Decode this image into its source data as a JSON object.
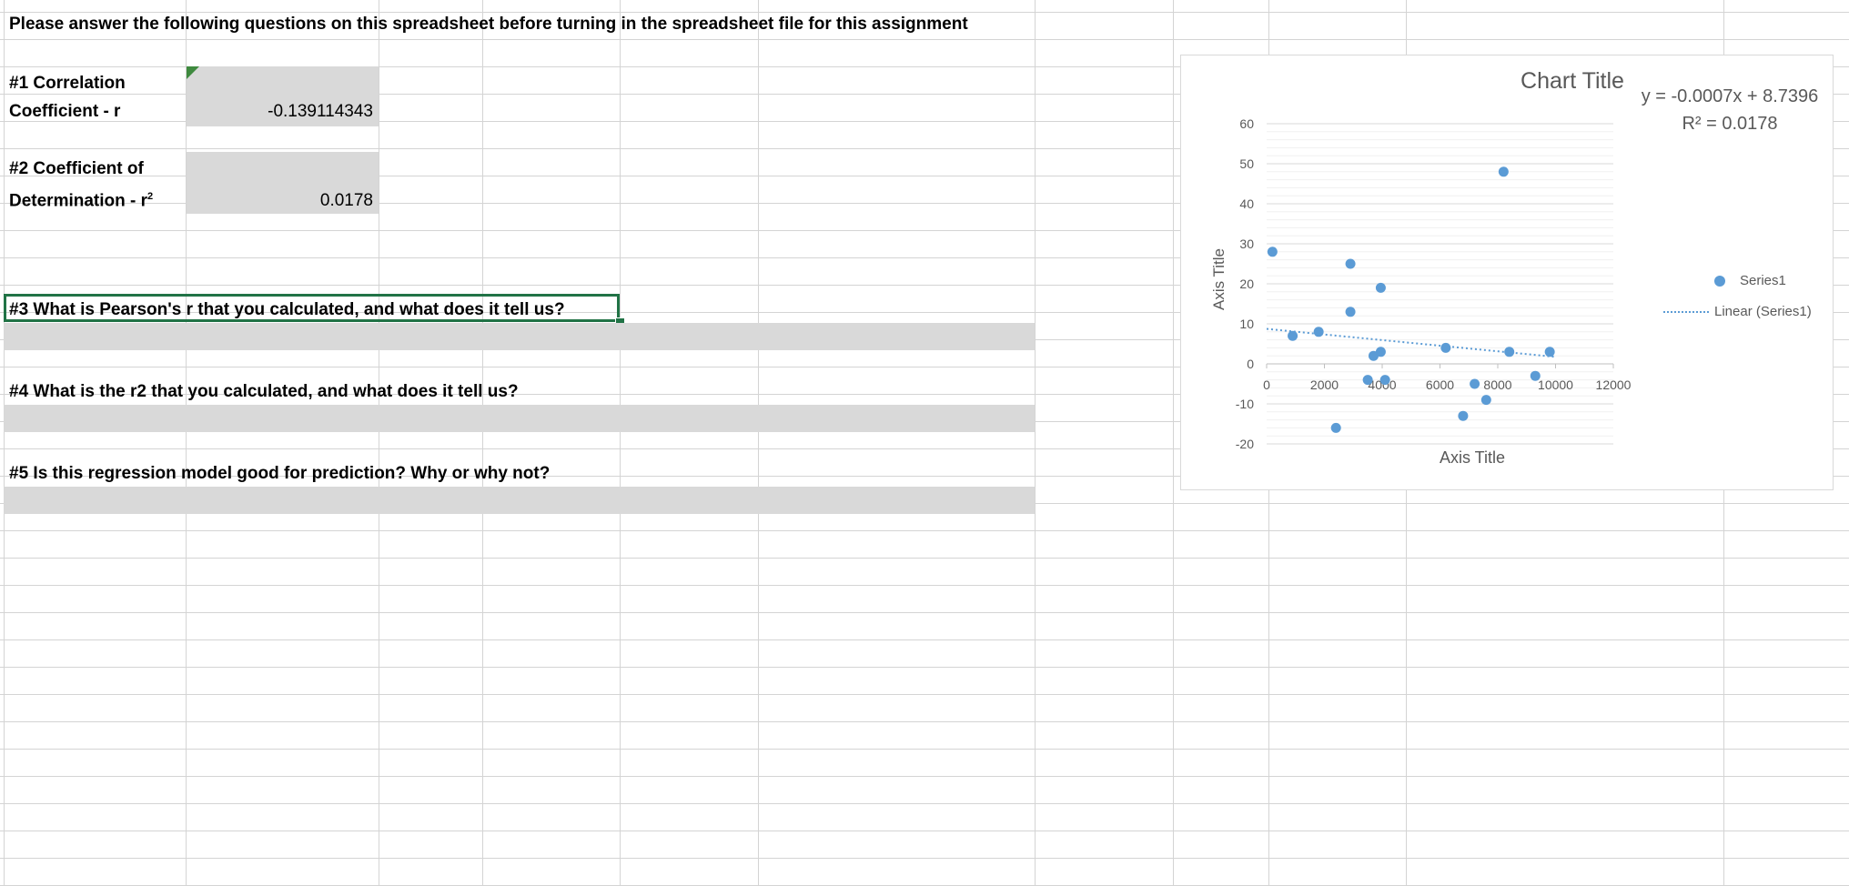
{
  "sheet": {
    "instruction": "Please answer the following questions on this spreadsheet before turning in the spreadsheet file for this assignment",
    "q1": {
      "line1": "#1 Correlation",
      "line2": "Coefficient - r",
      "value": "-0.139114343"
    },
    "q2": {
      "line1": "#2 Coefficient of",
      "line2": "Determination - r",
      "sup": "2",
      "value": "0.0178"
    },
    "q3": "#3  What is Pearson's r that you calculated, and what does it tell us?",
    "q4": "#4 What is the r2 that you calculated, and what does it tell us?",
    "q5": "#5 Is this regression model good for prediction? Why or why not?"
  },
  "colors": {
    "grid": "#d4d4d4",
    "answer_shade": "#d9d9d9",
    "selection": "#217346",
    "marker": "#5b9bd5",
    "chart_text": "#595959"
  },
  "chart_data": {
    "type": "scatter",
    "title": "Chart Title",
    "xlabel": "Axis Title",
    "ylabel": "Axis Title",
    "xlim": [
      0,
      12000
    ],
    "ylim": [
      -20,
      60
    ],
    "x_ticks": [
      "0",
      "2000",
      "4000",
      "6000",
      "8000",
      "10000",
      "12000"
    ],
    "y_ticks": [
      "60",
      "50",
      "40",
      "30",
      "20",
      "10",
      "0",
      "-10",
      "-20"
    ],
    "grid": true,
    "legend_position": "right",
    "trendline_equation": "y = -0.0007x + 8.7396",
    "trendline_r2": "R² = 0.0178",
    "series": [
      {
        "name": "Series1",
        "points": [
          [
            200,
            28
          ],
          [
            900,
            7
          ],
          [
            1800,
            8
          ],
          [
            2400,
            -16
          ],
          [
            2900,
            13
          ],
          [
            2900,
            25
          ],
          [
            3500,
            -4
          ],
          [
            3700,
            2
          ],
          [
            3950,
            3
          ],
          [
            3950,
            19
          ],
          [
            4100,
            -4
          ],
          [
            6200,
            4
          ],
          [
            6800,
            -13
          ],
          [
            7200,
            -5
          ],
          [
            7600,
            -9
          ],
          [
            8200,
            48
          ],
          [
            8400,
            3
          ],
          [
            9300,
            -3
          ],
          [
            9800,
            3
          ]
        ]
      }
    ],
    "trendline": {
      "name": "Linear (Series1)",
      "slope": -0.0007,
      "intercept": 8.7396,
      "x_range": [
        0,
        10000
      ]
    }
  }
}
